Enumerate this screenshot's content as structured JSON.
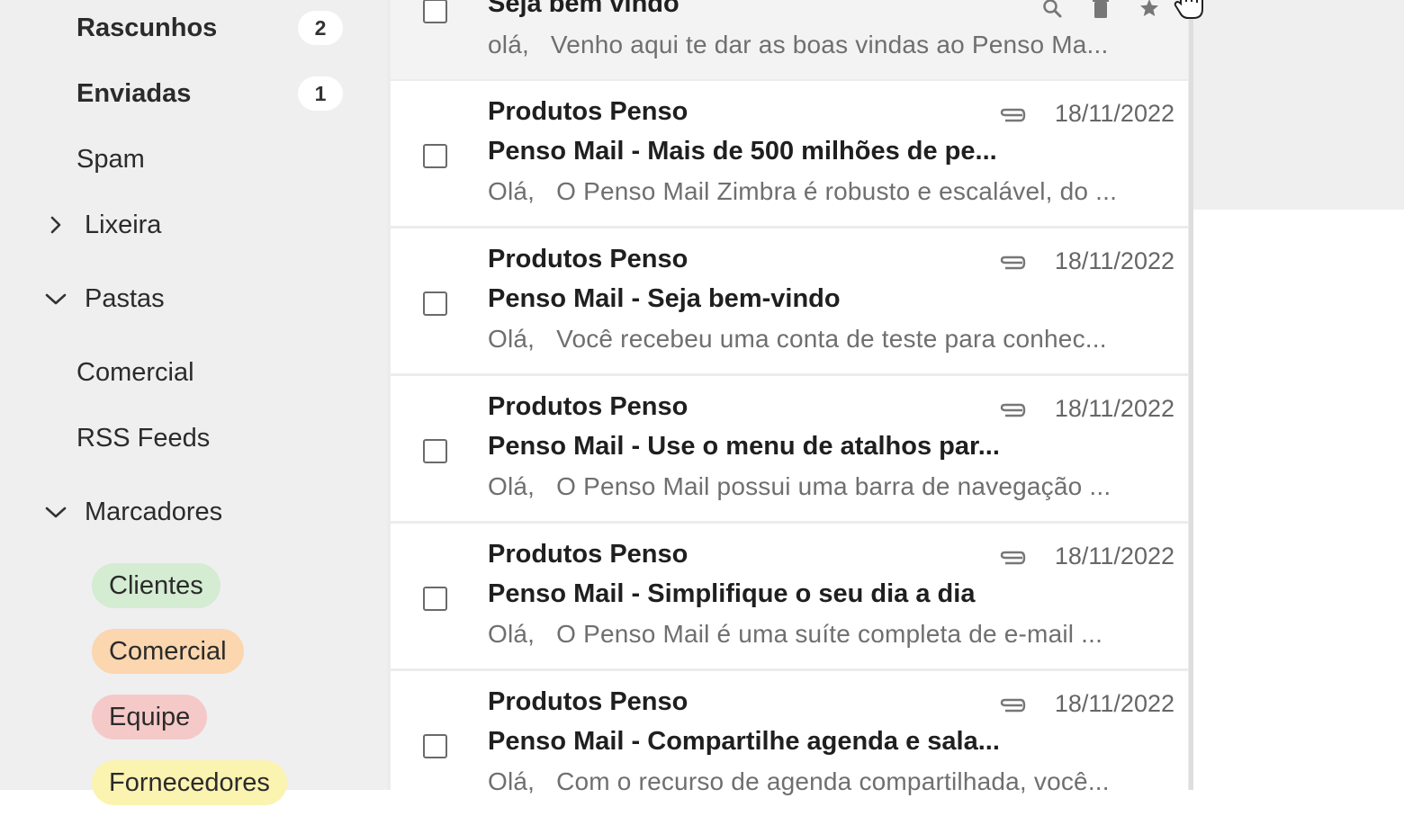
{
  "sidebar": {
    "items": [
      {
        "label": "Rascunhos",
        "count": "2"
      },
      {
        "label": "Enviadas",
        "count": "1"
      },
      {
        "label": "Spam"
      },
      {
        "label": "Lixeira"
      }
    ],
    "folders": {
      "label": "Pastas",
      "items": [
        {
          "label": "Comercial"
        },
        {
          "label": "RSS Feeds"
        }
      ]
    },
    "labels": {
      "label": "Marcadores",
      "tags": [
        {
          "label": "Clientes",
          "color": "#d4ecd2"
        },
        {
          "label": "Comercial",
          "color": "#fbd6ae"
        },
        {
          "label": "Equipe",
          "color": "#f6c9c9"
        },
        {
          "label": "Fornecedores",
          "color": "#fbf3b0"
        }
      ]
    }
  },
  "messages": [
    {
      "subject": "Seja bem vindo",
      "greeting": "olá,",
      "snippet": "Venho aqui te dar as boas vindas ao Penso Ma..."
    },
    {
      "sender": "Produtos Penso",
      "date": "18/11/2022",
      "subject": "Penso Mail - Mais de 500 milhões de pe...",
      "greeting": "Olá,",
      "snippet": "O Penso Mail Zimbra é robusto e escalável, do ..."
    },
    {
      "sender": "Produtos Penso",
      "date": "18/11/2022",
      "subject": "Penso Mail - Seja bem-vindo",
      "greeting": "Olá,",
      "snippet": "Você recebeu uma conta de teste para conhec..."
    },
    {
      "sender": "Produtos Penso",
      "date": "18/11/2022",
      "subject": "Penso Mail - Use o menu de atalhos par...",
      "greeting": "Olá,",
      "snippet": "O Penso Mail possui uma barra de navegação ..."
    },
    {
      "sender": "Produtos Penso",
      "date": "18/11/2022",
      "subject": "Penso Mail - Simplifique o seu dia a dia",
      "greeting": "Olá,",
      "snippet": "O Penso Mail é uma suíte completa de e-mail ..."
    },
    {
      "sender": "Produtos Penso",
      "date": "18/11/2022",
      "subject": "Penso Mail - Compartilhe agenda e sala...",
      "greeting": "Olá,",
      "snippet": "Com o recurso de agenda compartilhada, você..."
    }
  ]
}
